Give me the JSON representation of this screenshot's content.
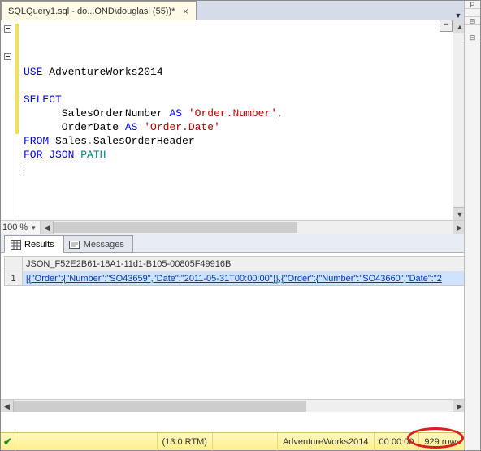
{
  "tab": {
    "title": "SQLQuery1.sql - do...OND\\douglasl (55))*"
  },
  "code": {
    "lines": [
      {
        "seg": [
          {
            "t": "USE",
            "c": "kw"
          },
          {
            "t": " AdventureWorks2014",
            "c": ""
          }
        ]
      },
      {
        "seg": []
      },
      {
        "seg": [
          {
            "t": "SELECT",
            "c": "kw"
          }
        ]
      },
      {
        "seg": [
          {
            "t": "      SalesOrderNumber ",
            "c": ""
          },
          {
            "t": "AS",
            "c": "kw"
          },
          {
            "t": " ",
            "c": ""
          },
          {
            "t": "'Order.Number'",
            "c": "str"
          },
          {
            "t": ",",
            "c": "gray"
          }
        ]
      },
      {
        "seg": [
          {
            "t": "      OrderDate ",
            "c": ""
          },
          {
            "t": "AS",
            "c": "kw"
          },
          {
            "t": " ",
            "c": ""
          },
          {
            "t": "'Order.Date'",
            "c": "str"
          }
        ]
      },
      {
        "seg": [
          {
            "t": "FROM",
            "c": "kw"
          },
          {
            "t": " Sales",
            "c": ""
          },
          {
            "t": ".",
            "c": "gray"
          },
          {
            "t": "SalesOrderHeader",
            "c": ""
          }
        ]
      },
      {
        "seg": [
          {
            "t": "FOR",
            "c": "kw"
          },
          {
            "t": " ",
            "c": ""
          },
          {
            "t": "JSON",
            "c": "kw"
          },
          {
            "t": " ",
            "c": ""
          },
          {
            "t": "PATH",
            "c": "teal"
          }
        ]
      },
      {
        "seg": [],
        "caret": true
      }
    ],
    "changebar_lines": 8
  },
  "zoom": {
    "level": "100 %"
  },
  "result_tabs": {
    "results": "Results",
    "messages": "Messages"
  },
  "grid": {
    "header_rowcorner": "",
    "column": "JSON_F52E2B61-18A1-11d1-B105-00805F49916B",
    "rownum": "1",
    "cell": "[{\"Order\":{\"Number\":\"SO43659\",\"Date\":\"2011-05-31T00:00:00\"}},{\"Order\":{\"Number\":\"SO43660\",\"Date\":\"2"
  },
  "status": {
    "version": "(13.0 RTM)",
    "db": "AdventureWorks2014",
    "time": "00:00:00",
    "rows": "929 rows"
  },
  "right_marks": [
    "P",
    "",
    "⊟",
    "",
    "⊟"
  ]
}
